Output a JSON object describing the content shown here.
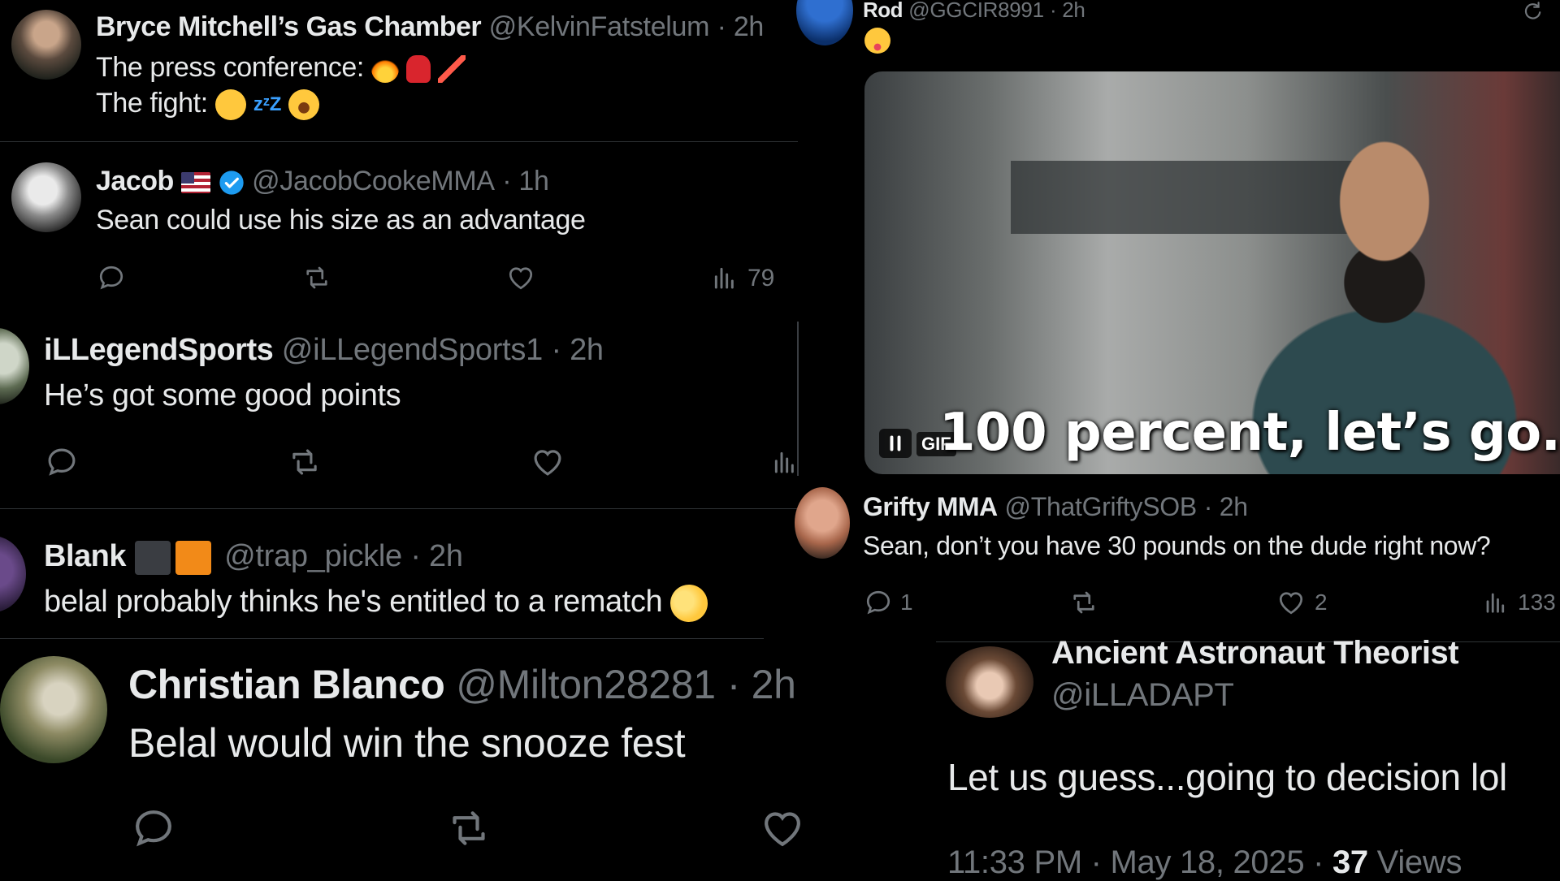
{
  "tweet1": {
    "name": "Bryce Mitchell’s Gas Chamber",
    "handle": "@KelvinFatstelum",
    "time": "· 2h",
    "line1": "The press conference:",
    "line2": "The fight:"
  },
  "tweet2": {
    "name": "Jacob",
    "handle": "@JacobCookeMMA",
    "time": "· 1h",
    "text": "Sean could use his size as an advantage",
    "views": "79"
  },
  "tweet3": {
    "name": "iLLegendSports",
    "handle": "@iLLegendSports1",
    "time": "· 2h",
    "text": "He’s got some good points"
  },
  "tweet4": {
    "name": "Blank",
    "handle": "@trap_pickle",
    "time": "· 2h",
    "text": "belal probably thinks he's entitled to a rematch"
  },
  "tweet5": {
    "name": "Christian Blanco",
    "handle": "@Milton28281",
    "time": "· 2h",
    "text": "Belal would win the snooze fest"
  },
  "tweet6": {
    "name": "Rod",
    "handle": "@GGCIR8991",
    "time": "· 2h",
    "gif_label": "GIF",
    "gif_caption": "100 percent, let’s go."
  },
  "tweet7": {
    "name": "Grifty MMA",
    "handle": "@ThatGriftySOB",
    "time": "· 2h",
    "text": "Sean, don’t you have 30 pounds on the dude right now?",
    "replies": "1",
    "likes": "2",
    "views": "133"
  },
  "tweet8": {
    "name": "Ancient Astronaut Theorist",
    "handle": "@iLLADAPT",
    "text": "Let us guess...going to decision lol",
    "meta_time": "11:33 PM · May 18, 2025 ·",
    "views_count": "37",
    "views_label": "Views"
  },
  "colors": {
    "background": "#000000",
    "text": "#e7e9ea",
    "muted": "#71767b",
    "divider": "#2f3336",
    "verified": "#1d9bf0"
  },
  "icons": [
    "reply-icon",
    "retweet-icon",
    "like-icon",
    "views-icon",
    "verified-icon",
    "refresh-icon",
    "pause-icon"
  ]
}
